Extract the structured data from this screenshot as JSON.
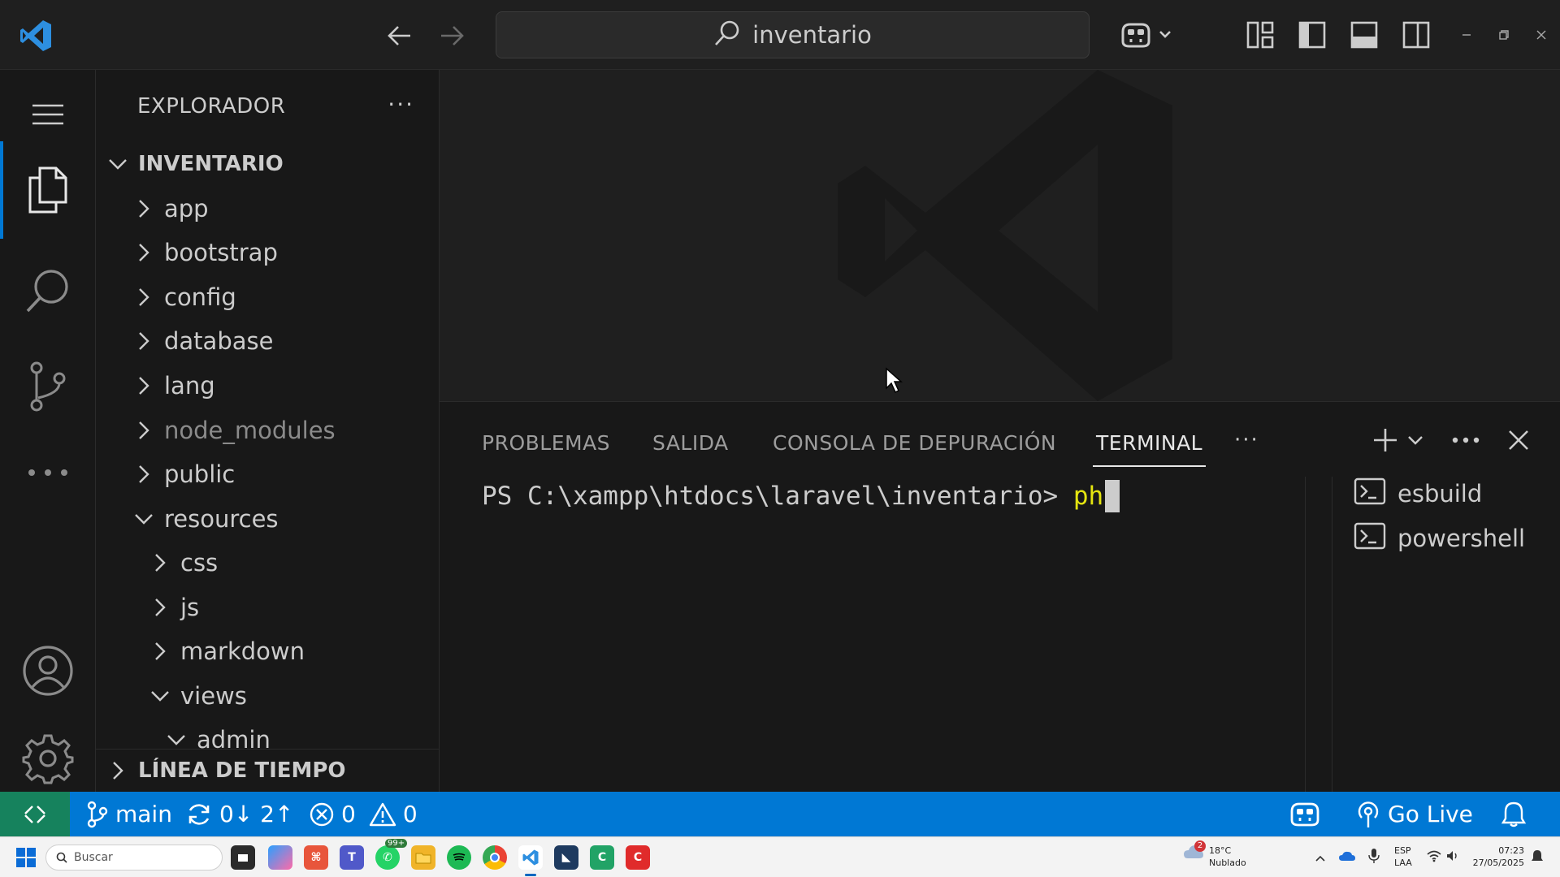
{
  "titlebar": {
    "search_text": "inventario"
  },
  "explorer": {
    "header": "EXPLORADOR",
    "more": "···",
    "root": "INVENTARIO",
    "items": [
      {
        "label": "app",
        "state": "collapsed",
        "level": 1,
        "dim": false
      },
      {
        "label": "bootstrap",
        "state": "collapsed",
        "level": 1,
        "dim": false
      },
      {
        "label": "config",
        "state": "collapsed",
        "level": 1,
        "dim": false
      },
      {
        "label": "database",
        "state": "collapsed",
        "level": 1,
        "dim": false
      },
      {
        "label": "lang",
        "state": "collapsed",
        "level": 1,
        "dim": false
      },
      {
        "label": "node_modules",
        "state": "collapsed",
        "level": 1,
        "dim": true
      },
      {
        "label": "public",
        "state": "collapsed",
        "level": 1,
        "dim": false
      },
      {
        "label": "resources",
        "state": "expanded",
        "level": 1,
        "dim": false
      },
      {
        "label": "css",
        "state": "collapsed",
        "level": 2,
        "dim": false
      },
      {
        "label": "js",
        "state": "collapsed",
        "level": 2,
        "dim": false
      },
      {
        "label": "markdown",
        "state": "collapsed",
        "level": 2,
        "dim": false
      },
      {
        "label": "views",
        "state": "expanded",
        "level": 2,
        "dim": false
      },
      {
        "label": "admin",
        "state": "expanded",
        "level": 3,
        "dim": false
      }
    ],
    "timeline": "LÍNEA DE TIEMPO"
  },
  "panel": {
    "tabs": [
      {
        "label": "PROBLEMAS",
        "active": false
      },
      {
        "label": "SALIDA",
        "active": false
      },
      {
        "label": "CONSOLA DE DEPURACIÓN",
        "active": false
      },
      {
        "label": "TERMINAL",
        "active": true
      }
    ],
    "more": "···",
    "terminal": {
      "prompt": "PS C:\\xampp\\htdocs\\laravel\\inventario> ",
      "typed": "ph"
    },
    "terminals": [
      "esbuild",
      "powershell"
    ]
  },
  "statusbar": {
    "branch": "main",
    "sync": "0↓ 2↑",
    "errors": "0",
    "warnings": "0",
    "go_live": "Go Live"
  },
  "taskbar": {
    "search_placeholder": "Buscar",
    "whatsapp_badge": "99+",
    "weather_badge": "2",
    "weather_temp": "18°C",
    "weather_desc": "Nublado",
    "lang_top": "ESP",
    "lang_bottom": "LAA",
    "time": "07:23",
    "date": "27/05/2025"
  },
  "colors": {
    "accent": "#0078d4",
    "remote": "#16825d",
    "terminal_typed": "#e5e510"
  }
}
